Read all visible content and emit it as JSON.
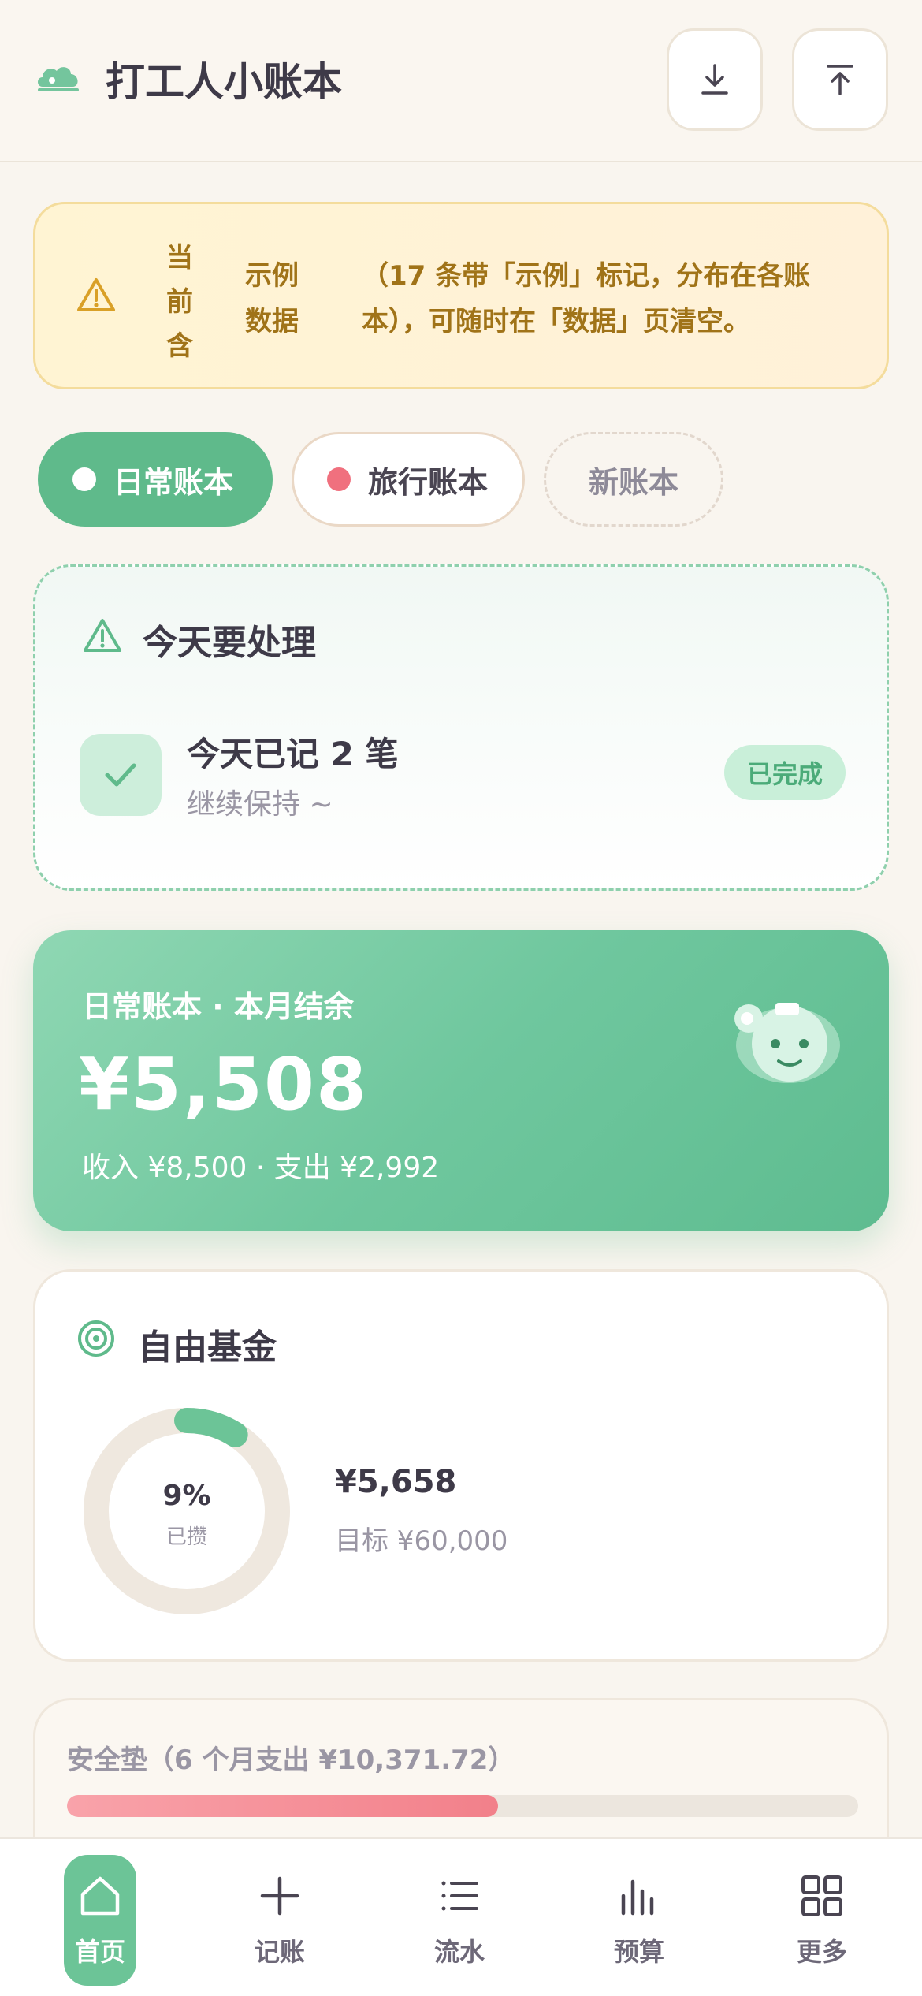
{
  "header": {
    "title": "打工人小账本",
    "logo_icon": "cloud-logo-icon",
    "import_icon": "download-icon",
    "export_icon": "upload-icon"
  },
  "notice": {
    "label": "当前含",
    "line1_a": "示例",
    "line1_b": "（17 条带「示例」标记，分布在各账",
    "line2_a": "数据",
    "line2_b": "本），可随时在「数据」页清空。",
    "icon": "warning-icon"
  },
  "books": {
    "daily": "日常账本",
    "travel": "旅行账本",
    "new": "新账本",
    "daily_color": "#ffffff",
    "travel_color": "#f0707e"
  },
  "today": {
    "title": "今天要处理",
    "task_title": "今天已记 2 笔",
    "task_sub": "继续保持 ~",
    "status": "已完成"
  },
  "balance": {
    "label": "日常账本 · 本月结余",
    "amount": "¥5,508",
    "summary": "收入 ¥8,500 · 支出 ¥2,992"
  },
  "fund": {
    "title": "自由基金",
    "percent_text": "9%",
    "percent_sub": "已攒",
    "progress": 0.09,
    "amount": "¥5,658",
    "goal": "目标 ¥60,000"
  },
  "cushion": {
    "title": "安全垫（6 个月支出 ¥10,371.72）",
    "progress": 0.545
  },
  "nav": {
    "home": "首页",
    "record": "记账",
    "flow": "流水",
    "budget": "预算",
    "more": "更多"
  },
  "colors": {
    "primary": "#5fba8b",
    "accent_red": "#f0707e",
    "warning": "#a07318"
  }
}
